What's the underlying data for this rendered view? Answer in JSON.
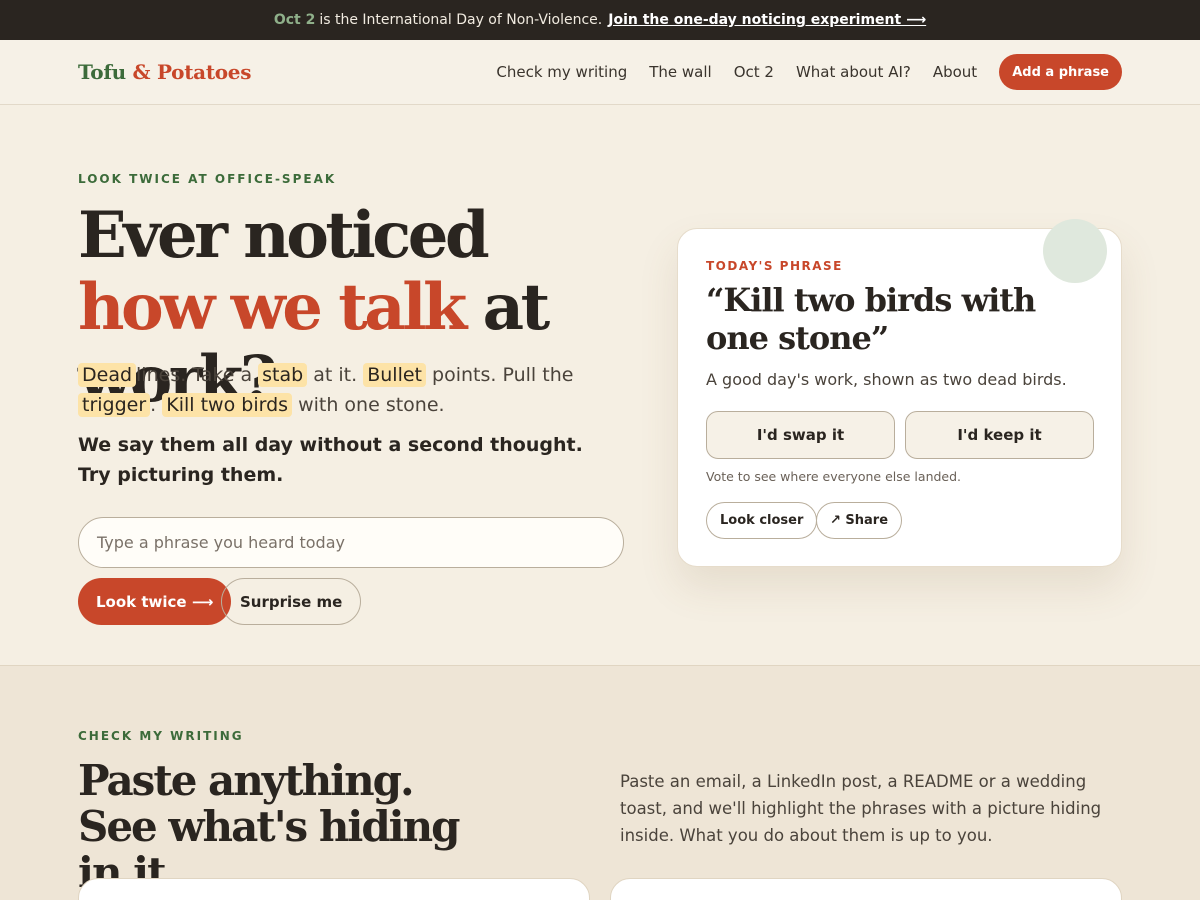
{
  "announcement": {
    "highlight": "Oct 2",
    "text": "is the International Day of Non-Violence.",
    "link": "Join the one-day noticing experiment ⟶"
  },
  "nav": {
    "logo_part1": "Tofu",
    "logo_amp": "&",
    "logo_part2": "Potatoes",
    "links": [
      "Check my writing",
      "The wall",
      "Oct 2",
      "What about AI?",
      "About"
    ],
    "cta": "Add a phrase"
  },
  "hero": {
    "eyebrow": "LOOK TWICE AT OFFICE-SPEAK",
    "headline_1": "Ever noticed",
    "headline_accent": "how we talk",
    "headline_2": "at work?",
    "lede": {
      "dead": "Dead",
      "t1": "lines. Take a",
      "stab": "stab",
      "t2": "at it.",
      "bullet": "Bullet",
      "t3": "points. Pull the",
      "trigger": "trigger",
      "t4": ".",
      "kill": "Kill two birds",
      "t5": "with one stone."
    },
    "strong": "We say them all day without a second thought. Try picturing them.",
    "search_placeholder": "Type a phrase you heard today",
    "primary_button": "Look twice ⟶",
    "secondary_button": "Surprise me"
  },
  "card": {
    "tag": "TODAY'S PHRASE",
    "phrase": "“Kill two birds with one stone”",
    "description": "A good day's work, shown as two dead birds.",
    "swap": "I'd swap it",
    "keep": "I'd keep it",
    "note": "Vote to see where everyone else landed.",
    "look_closer": "Look closer",
    "share": "↗ Share"
  },
  "section2": {
    "eyebrow": "CHECK MY WRITING",
    "title": "Paste anything. See what's hiding in it.",
    "text": "Paste an email, a LinkedIn post, a README or a wedding toast, and we'll highlight the phrases with a picture hiding inside. What you do about them is up to you."
  }
}
